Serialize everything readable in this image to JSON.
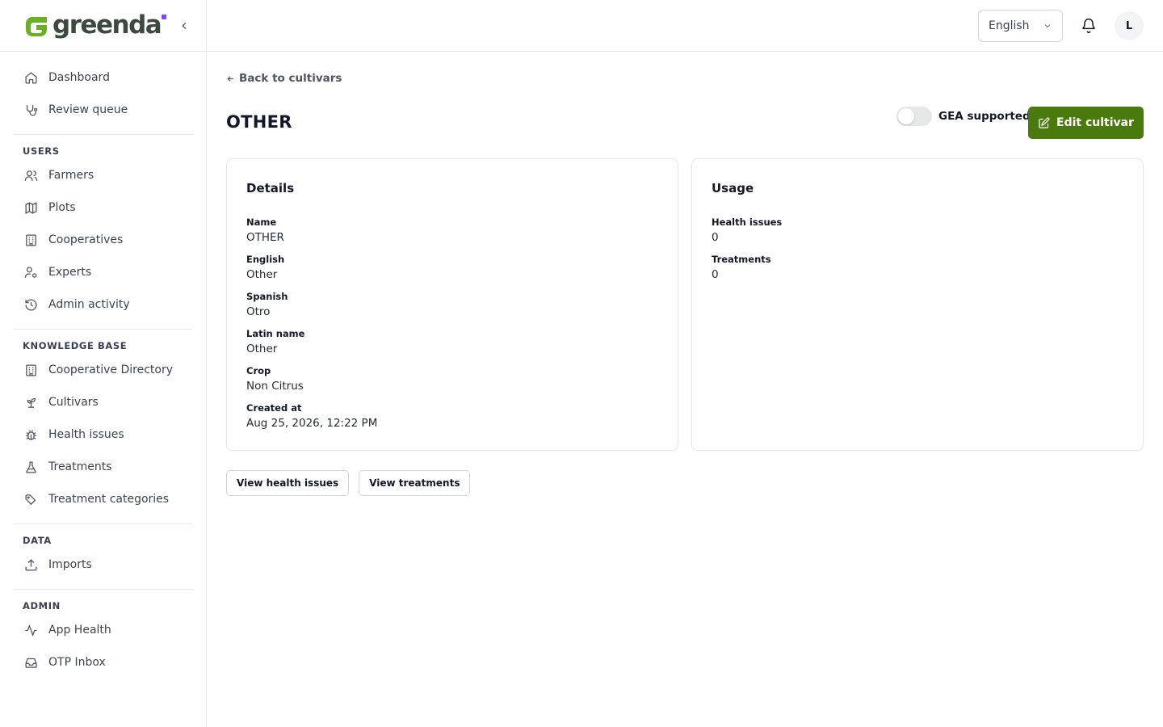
{
  "brand": {
    "name": "greenda",
    "accent": "#4a7a0c",
    "logo_g_color": "#6ab023",
    "dot_color": "#8b3ff5"
  },
  "sidebar": {
    "top_items": [
      {
        "label": "Dashboard",
        "icon": "home-icon"
      },
      {
        "label": "Review queue",
        "icon": "stethoscope-icon"
      }
    ],
    "sections": [
      {
        "title": "USERS",
        "items": [
          {
            "label": "Farmers",
            "icon": "users-icon"
          },
          {
            "label": "Plots",
            "icon": "map-icon"
          },
          {
            "label": "Cooperatives",
            "icon": "building-icon"
          },
          {
            "label": "Experts",
            "icon": "user-cog-icon"
          },
          {
            "label": "Admin activity",
            "icon": "history-icon"
          }
        ]
      },
      {
        "title": "KNOWLEDGE BASE",
        "items": [
          {
            "label": "Cooperative Directory",
            "icon": "building-icon"
          },
          {
            "label": "Cultivars",
            "icon": "sprout-icon"
          },
          {
            "label": "Health issues",
            "icon": "bug-icon"
          },
          {
            "label": "Treatments",
            "icon": "flask-icon"
          },
          {
            "label": "Treatment categories",
            "icon": "tags-icon"
          }
        ]
      },
      {
        "title": "DATA",
        "items": [
          {
            "label": "Imports",
            "icon": "upload-icon"
          }
        ]
      },
      {
        "title": "ADMIN",
        "items": [
          {
            "label": "App Health",
            "icon": "activity-icon"
          },
          {
            "label": "OTP Inbox",
            "icon": "inbox-icon"
          }
        ]
      }
    ]
  },
  "topbar": {
    "language": "English",
    "avatar_initial": "L"
  },
  "page": {
    "back_label": "Back to cultivars",
    "title": "OTHER",
    "gea_label": "GEA supported",
    "gea_enabled": false,
    "edit_label": "Edit cultivar"
  },
  "details": {
    "title": "Details",
    "fields": [
      {
        "label": "Name",
        "value": "OTHER"
      },
      {
        "label": "English",
        "value": "Other"
      },
      {
        "label": "Spanish",
        "value": "Otro"
      },
      {
        "label": "Latin name",
        "value": "Other"
      },
      {
        "label": "Crop",
        "value": "Non Citrus"
      },
      {
        "label": "Created at",
        "value": "Aug 25, 2026, 12:22 PM"
      }
    ]
  },
  "usage": {
    "title": "Usage",
    "fields": [
      {
        "label": "Health issues",
        "value": "0"
      },
      {
        "label": "Treatments",
        "value": "0"
      }
    ]
  },
  "actions": {
    "view_health_issues": "View health issues",
    "view_treatments": "View treatments"
  }
}
